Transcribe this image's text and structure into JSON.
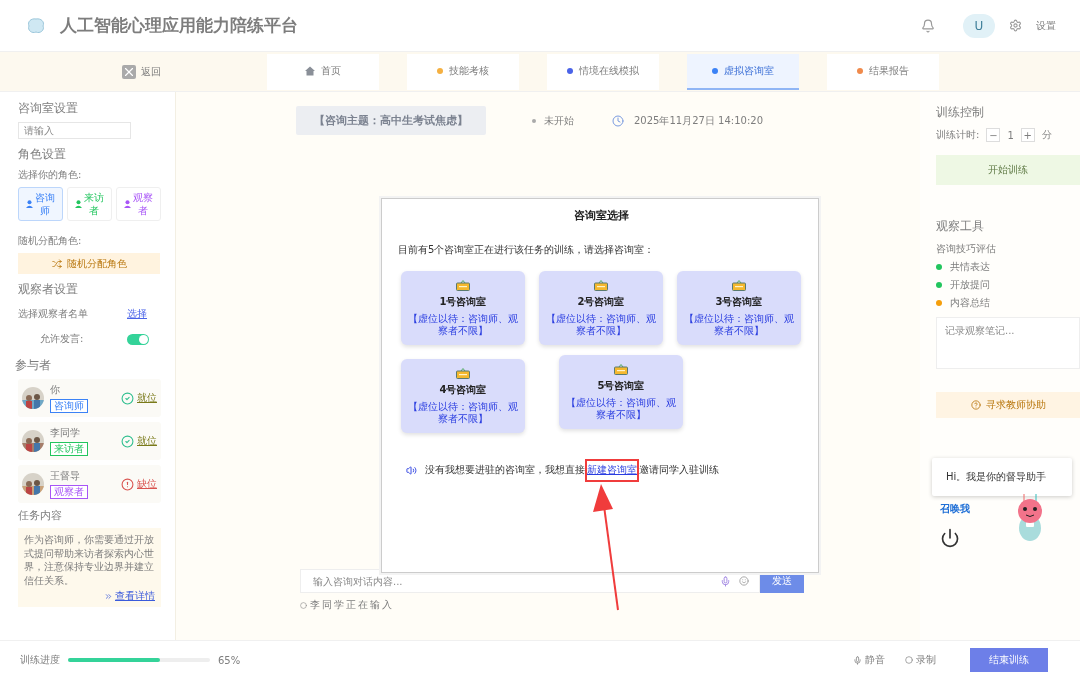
{
  "header": {
    "title": "人工智能心理应用能力陪练平台",
    "avatar": "U",
    "settings": "设置"
  },
  "nav": {
    "back": "返回",
    "tabs": [
      {
        "label": "首页",
        "kind": "home",
        "color": "#8a8f98",
        "selected": false
      },
      {
        "label": "技能考核",
        "kind": "dot",
        "color": "#f5b041",
        "selected": false
      },
      {
        "label": "情境在线模拟",
        "kind": "dot",
        "color": "#4a63e8",
        "selected": false
      },
      {
        "label": "虚拟咨询室",
        "kind": "dot",
        "color": "#3b82f6",
        "selected": true
      },
      {
        "label": "结果报告",
        "kind": "dot",
        "color": "#f08a4b",
        "selected": false
      }
    ]
  },
  "left": {
    "room_title": "咨询室设置",
    "room_placeholder": "请输入",
    "role_title": "角色设置",
    "role_prompt": "选择你的角色:",
    "roles": [
      {
        "label": "咨询师",
        "color": "#3b82f6",
        "selected": true
      },
      {
        "label": "来访者",
        "color": "#22c55e",
        "selected": false
      },
      {
        "label": "观察者",
        "color": "#a855f7",
        "selected": false
      }
    ],
    "random_label": "随机分配角色:",
    "random_button": "随机分配角色",
    "observer_title": "观察者设置",
    "observer_list": "选择观察者名单",
    "choose": "选择",
    "allow_label": "允许发言:",
    "allow_on": true,
    "participants_title": "参与者",
    "participants": [
      {
        "name": "你",
        "role": "咨询师",
        "color": "#3b82f6",
        "ready": true,
        "status": "就位"
      },
      {
        "name": "李同学",
        "role": "来访者",
        "color": "#22c55e",
        "ready": true,
        "status": "就位"
      },
      {
        "name": "王督导",
        "role": "观察者",
        "color": "#a855f7",
        "ready": false,
        "status": "缺位"
      }
    ],
    "task_title": "任务内容",
    "task_text": "作为咨询师，你需要通过开放式提问帮助来访者探索内心世界，注意保持专业边界并建立信任关系。",
    "details": "查看详情"
  },
  "center": {
    "topic": "【咨询主题：高中生考试焦虑】",
    "status": "未开始",
    "datetime": "2025年11月27日 14:10:20",
    "input_placeholder": "输入咨询对话内容...",
    "send": "发送",
    "typing": "李同学正在输入"
  },
  "right": {
    "control_title": "训练控制",
    "timer_label": "训练计时:",
    "minus": "−",
    "timer_value": "1",
    "plus": "+",
    "unit": "分",
    "start": "开始训练",
    "tools_title": "观察工具",
    "eval_label": "咨询技巧评估",
    "skills": [
      {
        "label": "共情表达",
        "color": "#22c55e"
      },
      {
        "label": "开放提问",
        "color": "#22c55e"
      },
      {
        "label": "内容总结",
        "color": "#f59e0b"
      }
    ],
    "notes_placeholder": "记录观察笔记...",
    "help": "寻求教师协助"
  },
  "footer": {
    "progress_label": "训练进度",
    "level": 0.65,
    "percent": "65%",
    "mute": "静音",
    "record": "录制",
    "end": "结束训练"
  },
  "modal": {
    "title": "咨询室选择",
    "intro": "目前有5个咨询室正在进行该任务的训练，请选择咨询室：",
    "rooms": [
      {
        "name": "1号咨询室",
        "note": "【虚位以待：咨询师、观察者不限】"
      },
      {
        "name": "2号咨询室",
        "note": "【虚位以待：咨询师、观察者不限】"
      },
      {
        "name": "3号咨询室",
        "note": "【虚位以待：咨询师、观察者不限】"
      },
      {
        "name": "4号咨询室",
        "note": "【虚位以待：咨询师、观察者不限】"
      },
      {
        "name": "5号咨询室",
        "note": "【虚位以待：咨询师、观察者不限】"
      }
    ],
    "hint_before": "没有我想要进驻的咨询室，我想直接",
    "link": "新建咨询室",
    "hint_after": "邀请同学入驻训练"
  },
  "assistant": {
    "greeting": "Hi。我是你的督导助手",
    "summon": "召唤我"
  }
}
